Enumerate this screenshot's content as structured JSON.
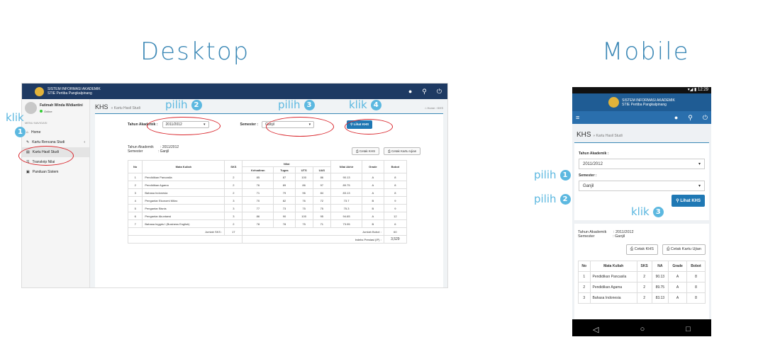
{
  "titles": {
    "desktop": "Desktop",
    "mobile": "Mobile"
  },
  "annotations": {
    "pilih": "pilih",
    "klik": "klik",
    "n1": "1",
    "n2": "2",
    "n3": "3",
    "n4": "4"
  },
  "desktop": {
    "brand_line1": "SISTEM INFORMASI AKADEMIK",
    "brand_line2": "STIE Pertiba Pangkalpinang",
    "user_name": "Fatimah Winda Widiantini",
    "user_status": "Online",
    "menu_header": "MENU NAVIGASI",
    "menu": [
      {
        "label": "Home",
        "icon": "home-icon"
      },
      {
        "label": "Kartu Rencana Studi",
        "icon": "pencil-icon"
      },
      {
        "label": "Kartu Hasil Studi",
        "icon": "document-icon"
      },
      {
        "label": "Transkrip Nilai",
        "icon": "list-icon"
      },
      {
        "label": "Panduan Sistem",
        "icon": "book-icon"
      }
    ],
    "page_title": "KHS",
    "page_subtitle": "» Kartu Hasil Studi",
    "breadcrumb": "⌂ Home › KHS",
    "filter": {
      "tahun_label": "Tahun Akademik :",
      "tahun_value": "2011/2012",
      "semester_label": "Semester :",
      "semester_value": "Ganjil",
      "button": "Lihat KHS"
    },
    "info": {
      "tahun_label": "Tahun Akademik",
      "tahun_value": ": 2011/2012",
      "semester_label": "Semester",
      "semester_value": ": Ganjil"
    },
    "buttons": {
      "cetak_khs": "Cetak KHS",
      "cetak_ujian": "Cetak Kartu Ujian"
    },
    "table": {
      "headers": {
        "no": "No",
        "mk": "Mata Kuliah",
        "sks": "SKS",
        "nilai": "Nilai",
        "kehadiran": "Kehadiran",
        "tugas": "Tugas",
        "uts": "UTS",
        "uas": "UAS",
        "akhir": "Nilai Akhir",
        "grade": "Grade",
        "bobot": "Bobot"
      },
      "rows": [
        [
          "1",
          "Pendidikan Pancasila",
          "2",
          "85",
          "87",
          "100",
          "86",
          "90.13",
          "A",
          "8"
        ],
        [
          "2",
          "Pendidikan Agama",
          "2",
          "76",
          "89",
          "86",
          "97",
          "89.75",
          "A",
          "8"
        ],
        [
          "3",
          "Bahasa Indonesia",
          "2",
          "71",
          "79",
          "96",
          "84",
          "83.13",
          "A",
          "8"
        ],
        [
          "4",
          "Pengantar Ekonomi Mikro",
          "3",
          "70",
          "82",
          "76",
          "72",
          "73.7",
          "B",
          "9"
        ],
        [
          "5",
          "Pengantar Bisnis",
          "3",
          "77",
          "73",
          "75",
          "75",
          "75.3",
          "B",
          "9"
        ],
        [
          "6",
          "Pengantar Akuntansi",
          "3",
          "86",
          "90",
          "100",
          "95",
          "94.65",
          "A",
          "12"
        ],
        [
          "7",
          "Bahasa Inggris I (Business English)",
          "2",
          "78",
          "78",
          "75",
          "71",
          "73.95",
          "B",
          "6"
        ]
      ],
      "jumlah_sks_label": "Jumlah SKS :",
      "jumlah_sks": "17",
      "jumlah_bobot_label": "Jumlah Bobot :",
      "jumlah_bobot": "60",
      "ip_label": "Indeks Prestasi (IP) :",
      "ip": "3,529"
    }
  },
  "mobile": {
    "status_time": "12:29",
    "brand_line1": "SISTEM INFORMASI AKADEMIK",
    "brand_line2": "STIE Pertiba Pangkalpinang",
    "page_title": "KHS",
    "page_subtitle": "» Kartu Hasil Studi",
    "tahun_label": "Tahun Akademik :",
    "tahun_value": "2011/2012",
    "semester_label": "Semester :",
    "semester_value": "Ganjil",
    "button": "Lihat KHS",
    "info": {
      "tahun_label": "Tahun Akademik",
      "tahun_value": ": 2011/2012",
      "semester_label": "Semester",
      "semester_value": ": Ganjil"
    },
    "cetak_khs": "Cetak KHS",
    "cetak_ujian": "Cetak Kartu Ujian",
    "headers": {
      "no": "No",
      "mk": "Mata Kuliah",
      "sks": "SKS",
      "na": "NA",
      "grade": "Grade",
      "bobot": "Bobot"
    },
    "rows": [
      [
        "1",
        "Pendidikan Pancasila",
        "2",
        "90.13",
        "A",
        "8"
      ],
      [
        "2",
        "Pendidikan Agama",
        "2",
        "89.75",
        "A",
        "8"
      ],
      [
        "3",
        "Bahasa Indonesia",
        "2",
        "83.13",
        "A",
        "8"
      ]
    ]
  },
  "colors": {
    "accent": "#3a87b5",
    "annotation": "#5cb8e0",
    "oval": "#d9262c",
    "button": "#1f78b4"
  }
}
